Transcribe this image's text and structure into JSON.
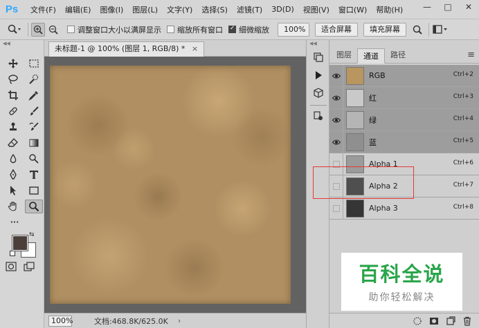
{
  "app": {
    "logo": "Ps"
  },
  "menu": [
    "文件(F)",
    "编辑(E)",
    "图像(I)",
    "图层(L)",
    "文字(Y)",
    "选择(S)",
    "滤镜(T)",
    "3D(D)",
    "视图(V)",
    "窗口(W)",
    "帮助(H)"
  ],
  "window_controls": {
    "minimize": "—",
    "maximize": "□",
    "close": "✕"
  },
  "options": {
    "resize_windows_label": "调整窗口大小以满屏显示",
    "zoom_all_label": "缩放所有窗口",
    "scrubby_zoom_label": "细微缩放",
    "zoom_value": "100%",
    "fit_screen_label": "适合屏幕",
    "fill_screen_label": "填充屏幕",
    "resize_windows_checked": false,
    "zoom_all_checked": false,
    "scrubby_zoom_checked": true
  },
  "document": {
    "tab_title": "未标题-1 @ 100% (图层 1, RGB/8) *",
    "close_glyph": "×",
    "zoom": "100%",
    "doc_info": "文档:468.8K/625.0K",
    "status_arrow": "›"
  },
  "toolbar": {
    "more": "···"
  },
  "colors": {
    "foreground": "#4a3f3a",
    "background": "#ffffff",
    "texture": "#b08f62",
    "highlight": "#e53935"
  },
  "panel": {
    "tabs": [
      "图层",
      "通道",
      "路径"
    ],
    "active_tab": "通道",
    "menu_glyph": "≡",
    "channels": [
      {
        "name": "RGB",
        "shortcut": "Ctrl+2",
        "visible": true,
        "selected": true,
        "thumb": "#b9955f"
      },
      {
        "name": "红",
        "shortcut": "Ctrl+3",
        "visible": true,
        "selected": true,
        "thumb": "#c9c9c9"
      },
      {
        "name": "绿",
        "shortcut": "Ctrl+4",
        "visible": true,
        "selected": true,
        "thumb": "#b5b5b5"
      },
      {
        "name": "蓝",
        "shortcut": "Ctrl+5",
        "visible": true,
        "selected": true,
        "thumb": "#8f8f8f"
      },
      {
        "name": "Alpha 1",
        "shortcut": "Ctrl+6",
        "visible": false,
        "selected": false,
        "thumb": "#9b9b9b"
      },
      {
        "name": "Alpha 2",
        "shortcut": "Ctrl+7",
        "visible": false,
        "selected": false,
        "thumb": "#4f4f4f"
      },
      {
        "name": "Alpha 3",
        "shortcut": "Ctrl+8",
        "visible": false,
        "selected": false,
        "thumb": "#353535"
      }
    ]
  },
  "watermark": {
    "logo": "百科全说",
    "sub": "助你轻松解决"
  }
}
